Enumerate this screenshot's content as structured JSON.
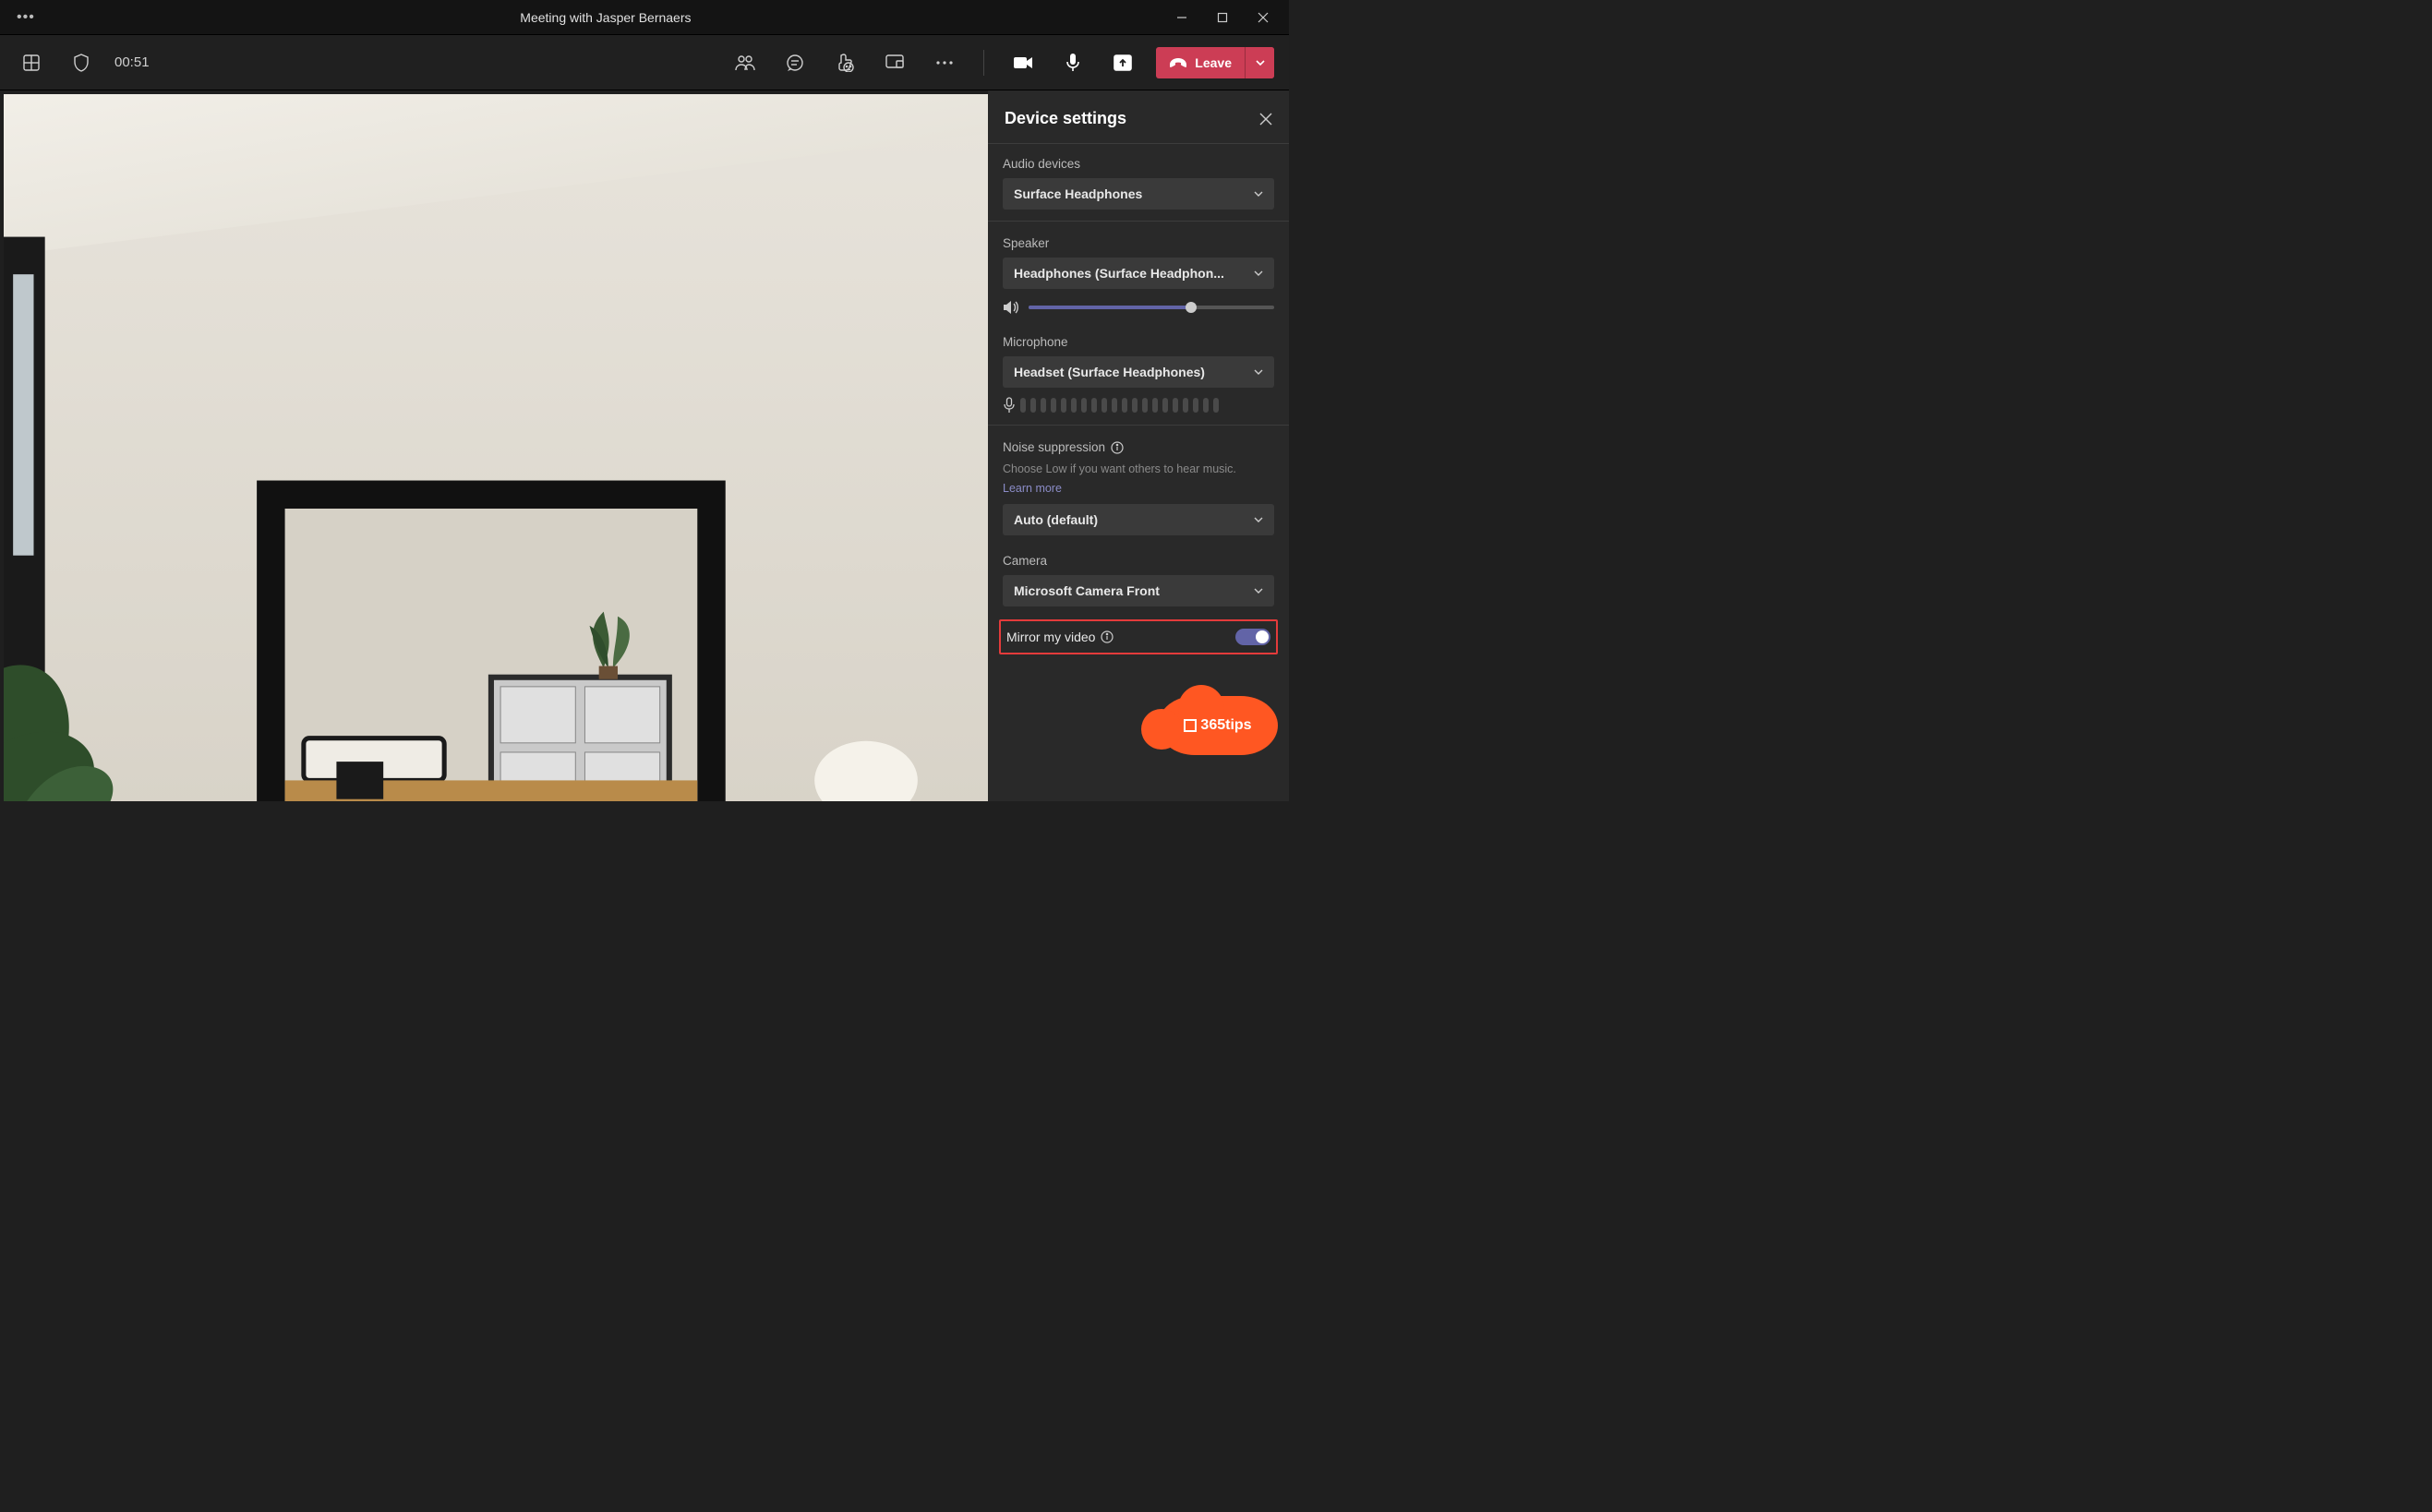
{
  "window": {
    "title": "Meeting with Jasper Bernaers"
  },
  "toolbar": {
    "timer": "00:51",
    "leave_label": "Leave"
  },
  "panel": {
    "title": "Device settings",
    "audio_devices": {
      "label": "Audio devices",
      "value": "Surface Headphones"
    },
    "speaker": {
      "label": "Speaker",
      "value": "Headphones (Surface Headphon...",
      "volume_percent": 66
    },
    "microphone": {
      "label": "Microphone",
      "value": "Headset (Surface Headphones)"
    },
    "noise_suppression": {
      "label": "Noise suppression",
      "description": "Choose Low if you want others to hear music.",
      "link": "Learn more",
      "value": "Auto (default)"
    },
    "camera": {
      "label": "Camera",
      "value": "Microsoft Camera Front"
    },
    "mirror": {
      "label": "Mirror my video",
      "enabled": true
    }
  },
  "branding": {
    "logo_text": "365tips"
  }
}
